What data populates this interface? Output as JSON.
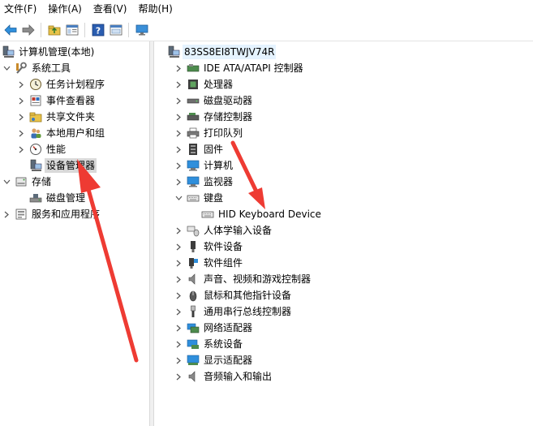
{
  "menu": [
    "文件(F)",
    "操作(A)",
    "查看(V)",
    "帮助(H)"
  ],
  "toolbar": {
    "icons": [
      "back-arrow-icon",
      "forward-arrow-icon",
      "up-folder-icon",
      "show-hide-tree-icon",
      "help-icon",
      "properties-icon",
      "monitor-icon"
    ]
  },
  "left_tree": {
    "root": "计算机管理(本地)",
    "system_tools": "系统工具",
    "task_scheduler": "任务计划程序",
    "event_viewer": "事件查看器",
    "shared_folders": "共享文件夹",
    "local_users": "本地用户和组",
    "performance": "性能",
    "device_manager": "设备管理器",
    "storage": "存储",
    "disk_management": "磁盘管理",
    "services_apps": "服务和应用程序"
  },
  "right_tree": {
    "computer_name": "83SS8EI8TWJV74R",
    "categories": [
      "IDE ATA/ATAPI 控制器",
      "处理器",
      "磁盘驱动器",
      "存储控制器",
      "打印队列",
      "固件",
      "计算机",
      "监视器",
      "键盘",
      "HID Keyboard Device",
      "人体学输入设备",
      "软件设备",
      "软件组件",
      "声音、视频和游戏控制器",
      "鼠标和其他指针设备",
      "通用串行总线控制器",
      "网络适配器",
      "系统设备",
      "显示适配器",
      "音频输入和输出"
    ]
  },
  "colors": {
    "arrow": "#ee3b33",
    "selection": "#d9d9d9",
    "hover": "#e5f3ff"
  }
}
